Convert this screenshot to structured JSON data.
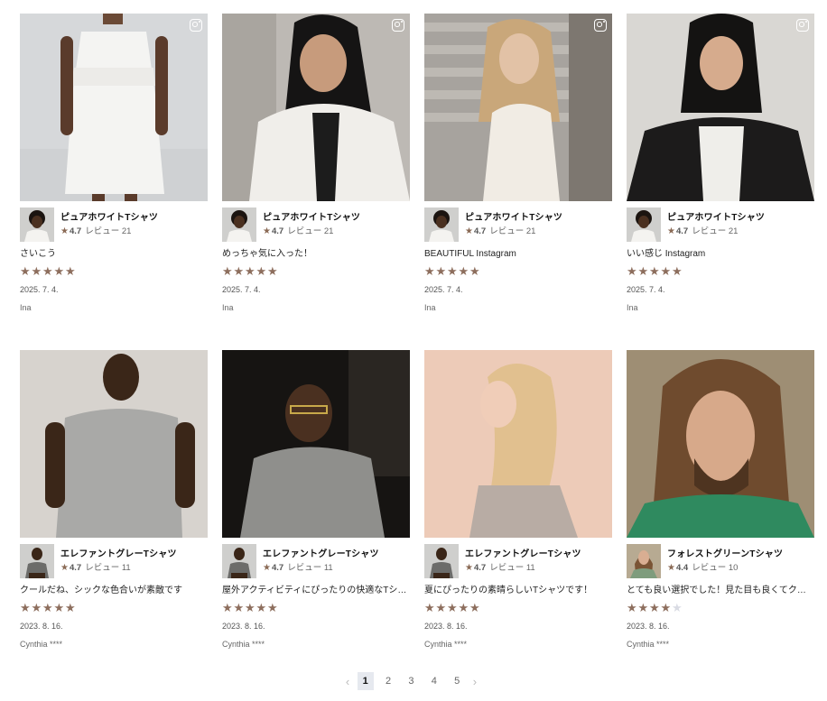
{
  "reviews": [
    {
      "product_name": "ピュアホワイトTシャツ",
      "rating_value": "4.7",
      "review_count": "レビュー 21",
      "title": "さいこう",
      "stars": 5,
      "date": "2025. 7. 4.",
      "author": "Ina",
      "photo_icon": "instagram-icon"
    },
    {
      "product_name": "ピュアホワイトTシャツ",
      "rating_value": "4.7",
      "review_count": "レビュー 21",
      "title": "めっちゃ気に入った！",
      "stars": 5,
      "date": "2025. 7. 4.",
      "author": "Ina",
      "photo_icon": "instagram-icon"
    },
    {
      "product_name": "ピュアホワイトTシャツ",
      "rating_value": "4.7",
      "review_count": "レビュー 21",
      "title": "BEAUTIFUL Instagram",
      "stars": 5,
      "date": "2025. 7. 4.",
      "author": "Ina",
      "photo_icon": "instagram-icon"
    },
    {
      "product_name": "ピュアホワイトTシャツ",
      "rating_value": "4.7",
      "review_count": "レビュー 21",
      "title": "いい感じ Instagram",
      "stars": 5,
      "date": "2025. 7. 4.",
      "author": "Ina",
      "photo_icon": "instagram-icon"
    },
    {
      "product_name": "エレファントグレーTシャツ",
      "rating_value": "4.7",
      "review_count": "レビュー 11",
      "title": "クールだね、シックな色合いが素敵です",
      "stars": 5,
      "date": "2023. 8. 16.",
      "author": "Cynthia ****"
    },
    {
      "product_name": "エレファントグレーTシャツ",
      "rating_value": "4.7",
      "review_count": "レビュー 11",
      "title": "屋外アクティビティにぴったりの快適なTシャツ…",
      "stars": 5,
      "date": "2023. 8. 16.",
      "author": "Cynthia ****"
    },
    {
      "product_name": "エレファントグレーTシャツ",
      "rating_value": "4.7",
      "review_count": "レビュー 11",
      "title": "夏にぴったりの素晴らしいTシャツです！",
      "stars": 5,
      "date": "2023. 8. 16.",
      "author": "Cynthia ****"
    },
    {
      "product_name": "フォレストグリーンTシャツ",
      "rating_value": "4.4",
      "review_count": "レビュー 10",
      "title": "とても良い選択でした！見た目も良くてクオリ…",
      "stars": 4,
      "date": "2023. 8. 16.",
      "author": "Cynthia ****"
    }
  ],
  "colors": {
    "star_filled": "#8d6e5d",
    "star_empty": "#d9dbe3",
    "pager_active_bg": "#e6e9ef"
  },
  "pagination": {
    "prev_icon": "chevron-left-icon",
    "next_icon": "chevron-right-icon",
    "pages": [
      "1",
      "2",
      "3",
      "4",
      "5"
    ],
    "current": "1"
  }
}
